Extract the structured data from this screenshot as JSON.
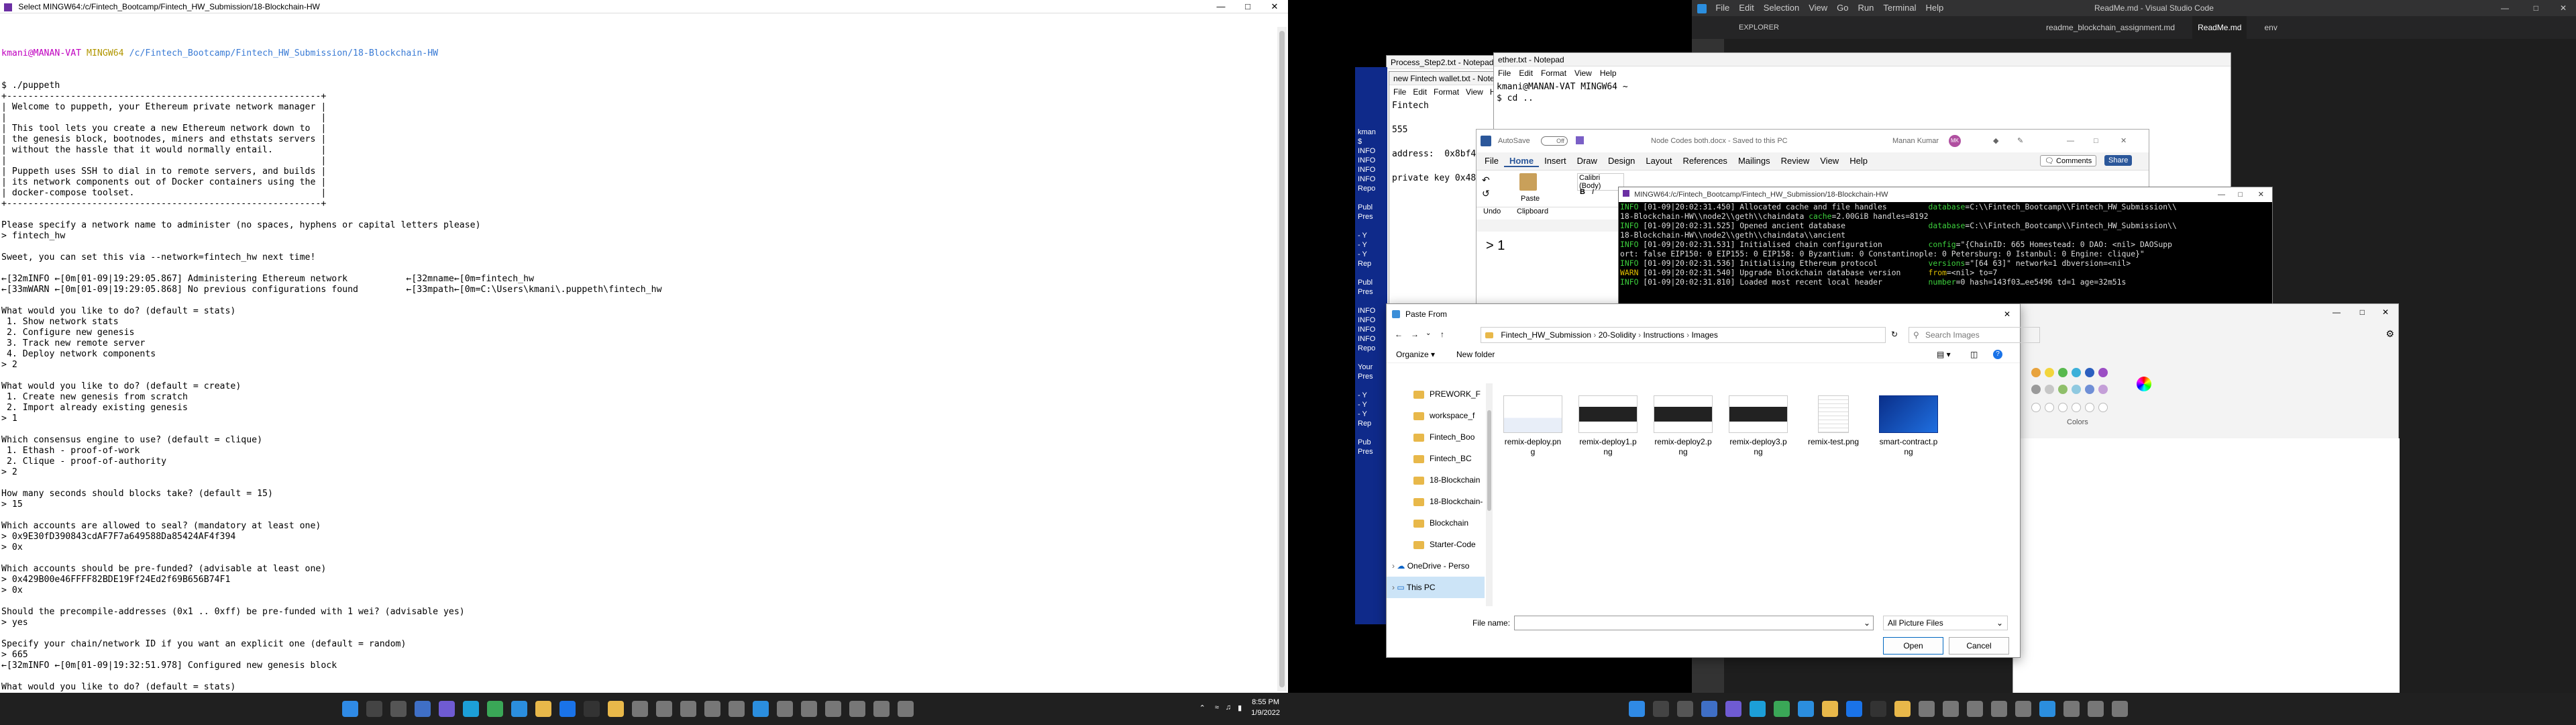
{
  "mingw_left": {
    "title": "Select MINGW64:/c/Fintech_Bootcamp/Fintech_HW_Submission/18-Blockchain-HW",
    "prompt_user": "kmani@MANAN-VAT",
    "prompt_env": "MINGW64",
    "prompt_path": "/c/Fintech_Bootcamp/Fintech_HW_Submission/18-Blockchain-HW",
    "lines": [
      "$ ./puppeth",
      "+-----------------------------------------------------------+",
      "| Welcome to puppeth, your Ethereum private network manager |",
      "|                                                           |",
      "| This tool lets you create a new Ethereum network down to  |",
      "| the genesis block, bootnodes, miners and ethstats servers |",
      "| without the hassle that it would normally entail.         |",
      "|                                                           |",
      "| Puppeth uses SSH to dial in to remote servers, and builds |",
      "| its network components out of Docker containers using the |",
      "| docker-compose toolset.                                   |",
      "+-----------------------------------------------------------+",
      "",
      "Please specify a network name to administer (no spaces, hyphens or capital letters please)",
      "> fintech_hw",
      "",
      "Sweet, you can set this via --network=fintech_hw next time!",
      "",
      "←[32mINFO ←[0m[01-09|19:29:05.867] Administering Ethereum network           ←[32mname←[0m=fintech_hw",
      "←[33mWARN ←[0m[01-09|19:29:05.868] No previous configurations found         ←[33mpath←[0m=C:\\Users\\kmani\\.puppeth\\fintech_hw",
      "",
      "What would you like to do? (default = stats)",
      " 1. Show network stats",
      " 2. Configure new genesis",
      " 3. Track new remote server",
      " 4. Deploy network components",
      "> 2",
      "",
      "What would you like to do? (default = create)",
      " 1. Create new genesis from scratch",
      " 2. Import already existing genesis",
      "> 1",
      "",
      "Which consensus engine to use? (default = clique)",
      " 1. Ethash - proof-of-work",
      " 2. Clique - proof-of-authority",
      "> 2",
      "",
      "How many seconds should blocks take? (default = 15)",
      "> 15",
      "",
      "Which accounts are allowed to seal? (mandatory at least one)",
      "> 0x9E30fD390843cdAF7F7a649588Da85424AF4f394",
      "> 0x",
      "",
      "Which accounts should be pre-funded? (advisable at least one)",
      "> 0x429B00e46FFFF82BDE19Ff24Ed2f69B656B74F1",
      "> 0x",
      "",
      "Should the precompile-addresses (0x1 .. 0xff) be pre-funded with 1 wei? (advisable yes)",
      "> yes",
      "",
      "Specify your chain/network ID if you want an explicit one (default = random)",
      "> 665",
      "←[32mINFO ←[0m[01-09|19:32:51.978] Configured new genesis block",
      "",
      "What would you like to do? (default = stats)",
      " 1. Show network stats",
      " 2. Manage existing genesis",
      " 3. Track new remote server",
      " 4. Deploy network components"
    ]
  },
  "taskbar_left": {
    "time": "8:55 PM",
    "date": "1/9/2022",
    "icons": [
      "windows-icon",
      "search-icon",
      "task-view-icon",
      "widgets-icon",
      "chat-icon",
      "edge-icon",
      "chrome-icon",
      "vscode-icon",
      "explorer-icon",
      "mail-icon",
      "terminal-icon",
      "folder-icon",
      "app-icon",
      "app-icon",
      "app-icon",
      "app-icon",
      "app-icon",
      "vscode-icon",
      "app-icon",
      "app-icon",
      "app-icon",
      "app-icon",
      "app-icon",
      "app-icon"
    ]
  },
  "taskbar_right": {
    "icons": [
      "windows-icon",
      "search-icon",
      "task-view-icon",
      "widgets-icon",
      "chat-icon",
      "edge-icon",
      "chrome-icon",
      "vscode-icon",
      "explorer-icon",
      "mail-icon",
      "terminal-icon",
      "folder-icon",
      "app-icon",
      "app-icon",
      "app-icon",
      "app-icon",
      "app-icon",
      "vscode-icon",
      "app-icon",
      "app-icon",
      "app-icon"
    ]
  },
  "vscode": {
    "title": "ReadMe.md - Visual Studio Code",
    "menu": [
      "File",
      "Edit",
      "Selection",
      "View",
      "Go",
      "Run",
      "Terminal",
      "Help"
    ],
    "explorer_label": "EXPLORER",
    "tabs": [
      "readme_blockchain_assignment.md",
      "ReadMe.md",
      "env"
    ]
  },
  "process_step": {
    "title": "Process_Step2.txt - Notepad"
  },
  "wallet_notepad": {
    "title": "new Fintech wallet.txt - Notepad",
    "menu": [
      "File",
      "Edit",
      "Format",
      "View",
      "Help"
    ],
    "lines": [
      "Fintech",
      "",
      "555",
      "",
      "address:  0x8bf4d",
      "",
      "private key 0x48b"
    ]
  },
  "ether_notepad": {
    "title": "ether.txt - Notepad",
    "menu": [
      "File",
      "Edit",
      "Format",
      "View",
      "Help"
    ],
    "prompt": "kmani@MANAN-VAT MINGW64 ~",
    "command": "$ cd .."
  },
  "word": {
    "autosave": "AutoSave",
    "toggle": "Off",
    "doc_title": "Node Codes both.docx - Saved to this PC",
    "user": "Manan Kumar",
    "user_initials": "MK",
    "tabs": [
      "File",
      "Home",
      "Insert",
      "Draw",
      "Design",
      "Layout",
      "References",
      "Mailings",
      "Review",
      "View",
      "Help"
    ],
    "comments_label": "Comments",
    "share_label": "Share",
    "undo_label": "Undo",
    "paste_label": "Paste",
    "clipboard_label": "Clipboard",
    "font": "Calibri (Body)",
    "body_text": "> 1"
  },
  "left_strip_text": [
    "kman",
    "$",
    "INFO",
    "INFO",
    "INFO",
    "INFO",
    "Repo",
    "",
    "Publ",
    "Pres",
    "",
    "- Y",
    "- Y",
    "- Y",
    "Rep",
    "",
    "Publ",
    "Pres",
    "",
    "INFO",
    "INFO",
    "INFO",
    "INFO",
    "Repo",
    "",
    "Your",
    "Pres",
    "",
    "- Y",
    "- Y",
    "- Y",
    "Rep",
    "",
    "Pub",
    "Pres"
  ],
  "geth_term": {
    "title": "MINGW64:/c/Fintech_Bootcamp/Fintech_HW_Submission/18-Blockchain-HW",
    "lines": [
      {
        "level": "INFO",
        "text": " [01-09|20:02:31.450] Allocated cache and file handles         ",
        "key": "database",
        "val": "=C:\\\\Fintech_Bootcamp\\\\Fintech_HW_Submission\\\\"
      },
      {
        "level": "",
        "text": "18-Blockchain-HW\\\\node2\\\\geth\\\\chaindata ",
        "key": "cache",
        "val": "=2.00GiB handles=8192"
      },
      {
        "level": "INFO",
        "text": " [01-09|20:02:31.525] Opened ancient database                  ",
        "key": "database",
        "val": "=C:\\\\Fintech_Bootcamp\\\\Fintech_HW_Submission\\\\"
      },
      {
        "level": "",
        "text": "18-Blockchain-HW\\\\node2\\\\geth\\\\chaindata\\\\ancient",
        "key": "",
        "val": ""
      },
      {
        "level": "INFO",
        "text": " [01-09|20:02:31.531] Initialised chain configuration          ",
        "key": "config",
        "val": "=\"{ChainID: 665 Homestead: 0 DAO: <nil> DAOSupp"
      },
      {
        "level": "",
        "text": "ort: false EIP150: 0 EIP155: 0 EIP158: 0 Byzantium: 0 Constantinople: 0 Petersburg: 0 Istanbul: 0 Engine: clique}\"",
        "key": "",
        "val": ""
      },
      {
        "level": "INFO",
        "text": " [01-09|20:02:31.536] Initialising Ethereum protocol           ",
        "key": "versions",
        "val": "=\"[64 63]\" network=1 dbversion=<nil>"
      },
      {
        "level": "WARN",
        "text": " [01-09|20:02:31.540] Upgrade blockchain database version      ",
        "key": "from",
        "val": "=<nil> to=7"
      },
      {
        "level": "INFO",
        "text": " [01-09|20:02:31.810] Loaded most recent local header          ",
        "key": "number",
        "val": "=0 hash=143f03…ee5496 td=1 age=32m51s"
      }
    ]
  },
  "paint_panel": {
    "colors_label": "Colors",
    "swatches_row1": [
      "#e8a33d",
      "#f2d53c",
      "#58b94e",
      "#3cb0d9",
      "#2b5fbf",
      "#9b4ec4"
    ],
    "swatches_row2": [
      "#9a9a9a",
      "#c7c7c7",
      "#8fbf6a",
      "#8fc9e0",
      "#6f8fd6",
      "#c49fd8"
    ]
  },
  "paste_dialog": {
    "title": "Paste From",
    "breadcrumb": [
      "Fintech_HW_Submission",
      "20-Solidity",
      "Instructions",
      "Images"
    ],
    "search_placeholder": "Search Images",
    "organize_label": "Organize",
    "new_folder_label": "New folder",
    "tree": [
      {
        "label": "PREWORK_F",
        "type": "folder"
      },
      {
        "label": "workspace_f",
        "type": "folder"
      },
      {
        "label": "Fintech_Boo",
        "type": "folder"
      },
      {
        "label": "Fintech_BC",
        "type": "folder"
      },
      {
        "label": "18-Blockchain",
        "type": "folder"
      },
      {
        "label": "18-Blockchain-",
        "type": "folder"
      },
      {
        "label": "Blockchain",
        "type": "folder"
      },
      {
        "label": "Starter-Code",
        "type": "folder"
      },
      {
        "label": "OneDrive - Perso",
        "type": "cloud"
      },
      {
        "label": "This PC",
        "type": "pc"
      }
    ],
    "files": [
      {
        "name": "remix-deploy.png",
        "style": "light"
      },
      {
        "name": "remix-deploy1.png",
        "style": "dark"
      },
      {
        "name": "remix-deploy2.png",
        "style": "dark"
      },
      {
        "name": "remix-deploy3.png",
        "style": "dark"
      },
      {
        "name": "remix-test.png",
        "style": "doc"
      },
      {
        "name": "smart-contract.png",
        "style": "blue"
      }
    ],
    "filename_label": "File name:",
    "filename_value": "",
    "filetype_value": "All Picture Files",
    "open_label": "Open",
    "cancel_label": "Cancel"
  }
}
